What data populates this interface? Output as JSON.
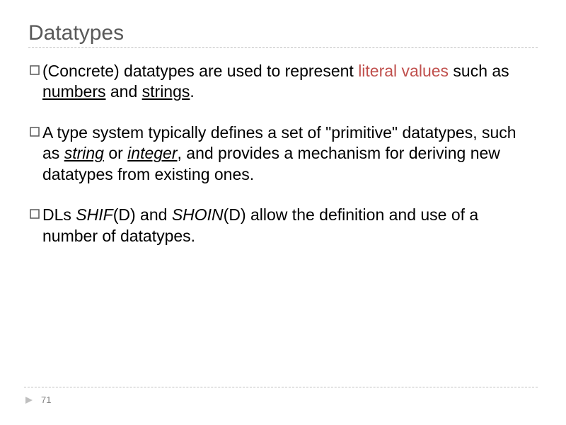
{
  "title": "Datatypes",
  "bullets": {
    "b1": {
      "lead": "(Concrete) datatypes are used to represent ",
      "literal": "literal values",
      "mid": " such as ",
      "numbers": "numbers",
      "and": " and ",
      "strings": "strings",
      "end": "."
    },
    "b2": {
      "p1": "A type system typically defines a set of \"primitive\" datatypes, such as ",
      "string": "string",
      "or": " or ",
      "integer": "integer",
      "p2": ", and provides a mechanism for deriving new datatypes from existing ones."
    },
    "b3": {
      "p1": "DLs ",
      "shif": "SHIF",
      "d1": "(",
      "dletter1": "D",
      "d1c": ") and ",
      "shoin": "SHOIN",
      "d2": "(",
      "dletter2": "D",
      "d2c": ") allow the definition and use of a number of datatypes."
    }
  },
  "page_number": "71"
}
